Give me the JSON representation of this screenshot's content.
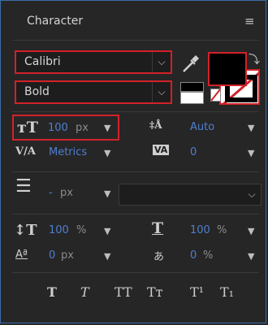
{
  "panel": {
    "title": "Character",
    "menu_icon": "≡"
  },
  "font": {
    "family": "Calibri",
    "style": "Bold"
  },
  "size": {
    "value": "100",
    "unit": "px"
  },
  "leading": {
    "value": "Auto"
  },
  "kerning": {
    "value": "Metrics"
  },
  "tracking": {
    "value": "0"
  },
  "stroke": {
    "value": "-",
    "unit": "px"
  },
  "scale": {
    "vertical": "100",
    "vertical_unit": "%",
    "horizontal": "100",
    "horizontal_unit": "%"
  },
  "baseline": {
    "value": "0",
    "unit": "px"
  },
  "tsume": {
    "value": "0",
    "unit": "%"
  },
  "typo_buttons": [
    "T",
    "T",
    "TT",
    "Tт",
    "T¹",
    "T₁"
  ],
  "colors": {
    "fill": "#000000",
    "accent": "#4f7fd0",
    "highlight": "#d1222a"
  }
}
